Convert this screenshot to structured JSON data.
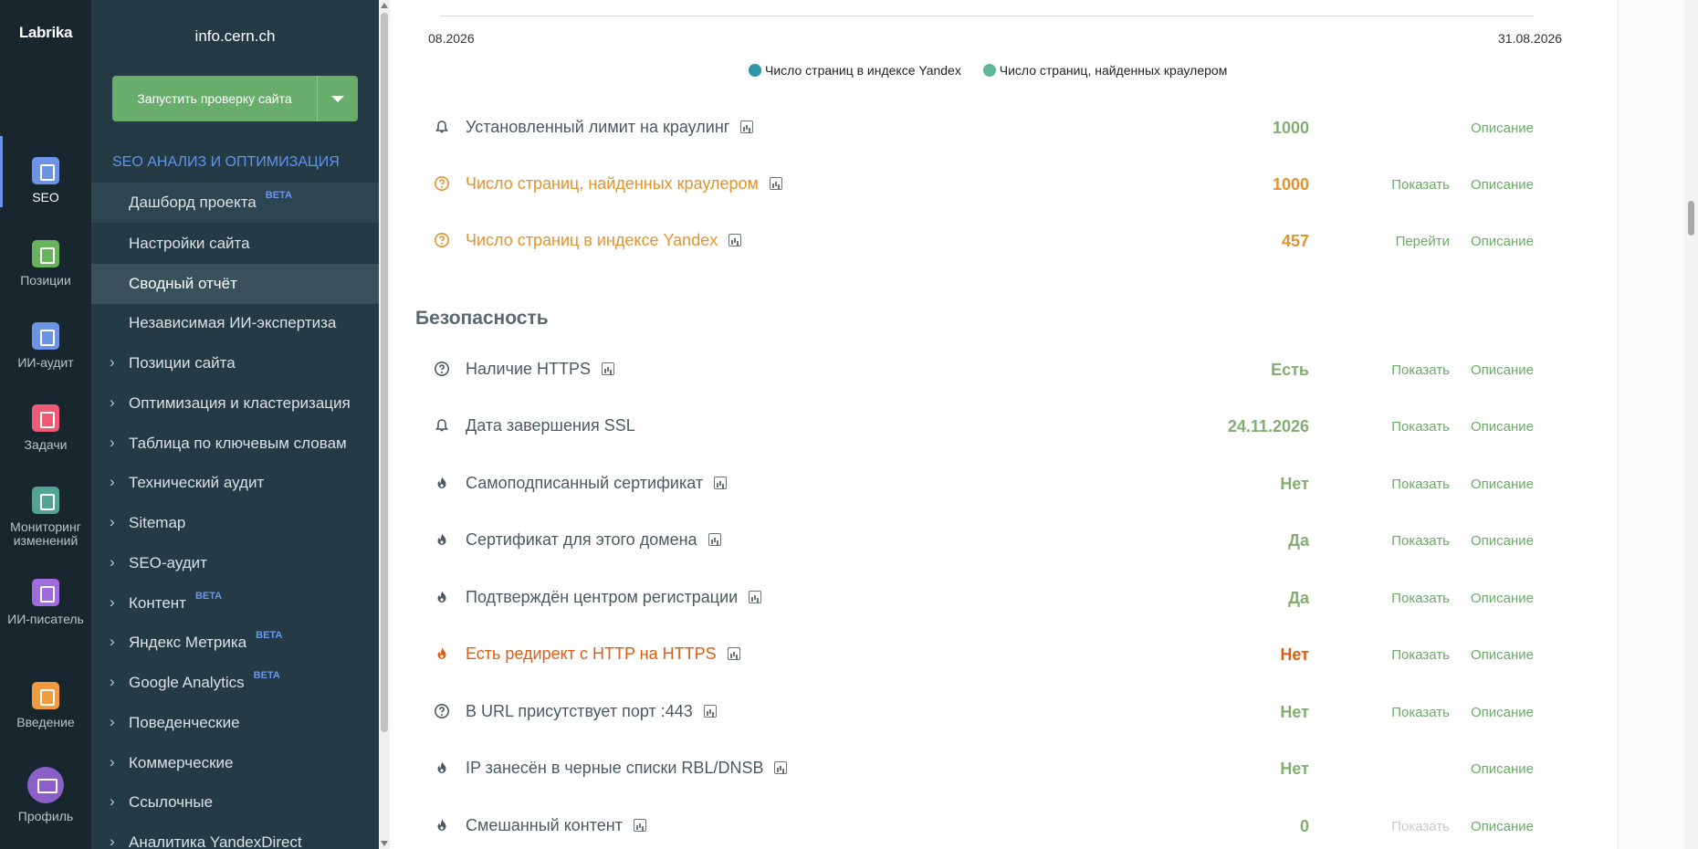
{
  "rail": {
    "logo": "Labrika",
    "items": [
      {
        "label": "SEO",
        "icon": "clipboard-icon",
        "color": "#6c93e6"
      },
      {
        "label": "Позиции",
        "icon": "chart-icon",
        "color": "#68b35c"
      },
      {
        "label": "ИИ-аудит",
        "icon": "clipboard-icon",
        "color": "#6c93e6"
      },
      {
        "label": "Задачи",
        "icon": "check-icon",
        "color": "#ef5b74"
      },
      {
        "label": "Мониторинг",
        "label2": "изменений",
        "icon": "monitor-icon",
        "color": "#53a395"
      },
      {
        "label": "ИИ-писатель",
        "icon": "magic-wand-icon",
        "color": "#a16be0"
      },
      {
        "label": "Введение",
        "icon": "question-icon",
        "color": "#f19a3e"
      },
      {
        "label": "Профиль",
        "icon": "avatar-icon",
        "color": "#8a60c8"
      }
    ]
  },
  "sidebar": {
    "site": "info.cern.ch",
    "run_button": "Запустить проверку сайта",
    "section": "SEO АНАЛИЗ И ОПТИМИЗАЦИЯ",
    "beta": "BETA",
    "items": [
      "Дашборд проекта",
      "Настройки сайта",
      "Сводный отчёт",
      "Независимая ИИ-экспертиза",
      "Позиции сайта",
      "Оптимизация и кластеризация",
      "Таблица по ключевым словам",
      "Технический аудит",
      "Sitemap",
      "SEO-аудит",
      "Контент",
      "Яндекс Метрика",
      "Google Analytics",
      "Поведенческие",
      "Коммерческие",
      "Ссылочные",
      "Аналитика YandexDirect"
    ]
  },
  "chart": {
    "date_left": "08.2026",
    "date_right": "31.08.2026",
    "legend": [
      {
        "label": "Число страниц в индексе Yandex",
        "color": "#2e95a6"
      },
      {
        "label": "Число страниц, найденных краулером",
        "color": "#5fb79a"
      }
    ]
  },
  "crawl_rows": [
    {
      "label": "Установленный лимит на краулинг",
      "value": "1000",
      "action": "",
      "desc": "Описание"
    },
    {
      "label": "Число страниц, найденных краулером",
      "value": "1000",
      "action": "Показать",
      "desc": "Описание"
    },
    {
      "label": "Число страниц в индексе Yandex",
      "value": "457",
      "action": "Перейти",
      "desc": "Описание"
    }
  ],
  "security": {
    "title": "Безопасность",
    "rows": [
      {
        "label": "Наличие HTTPS",
        "value": "Есть",
        "action": "Показать",
        "desc": "Описание"
      },
      {
        "label": "Дата завершения SSL",
        "value": "24.11.2026",
        "action": "Показать",
        "desc": "Описание"
      },
      {
        "label": "Самоподписанный сертификат",
        "value": "Нет",
        "action": "Показать",
        "desc": "Описание"
      },
      {
        "label": "Сертификат для этого домена",
        "value": "Да",
        "action": "Показать",
        "desc": "Описание"
      },
      {
        "label": "Подтверждён центром регистрации",
        "value": "Да",
        "action": "Показать",
        "desc": "Описание"
      },
      {
        "label": "Есть редирект с HTTP на HTTPS",
        "value": "Нет",
        "action": "Показать",
        "desc": "Описание"
      },
      {
        "label": "В URL присутствует порт :443",
        "value": "Нет",
        "action": "Показать",
        "desc": "Описание"
      },
      {
        "label": "IP занесён в черные списки RBL/DNSB",
        "value": "Нет",
        "action": "",
        "desc": "Описание"
      },
      {
        "label": "Смешанный контент",
        "value": "0",
        "action": "Показать",
        "desc": "Описание"
      }
    ]
  }
}
